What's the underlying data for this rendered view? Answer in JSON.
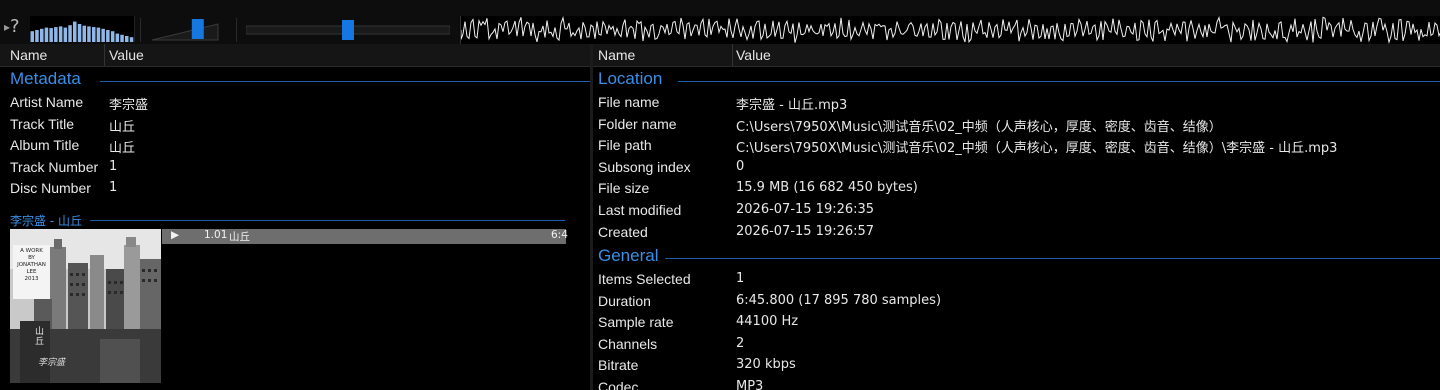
{
  "toolbar": {
    "help_label": "?",
    "icons": [
      "help-icon",
      "spectrum-visualizer",
      "volume-slider",
      "seek-slider",
      "waveform-seekbar"
    ],
    "spectrum_levels": [
      0.45,
      0.5,
      0.55,
      0.6,
      0.58,
      0.62,
      0.65,
      0.6,
      0.7,
      0.85,
      0.75,
      0.68,
      0.65,
      0.62,
      0.6,
      0.55,
      0.5,
      0.45,
      0.35,
      0.3,
      0.25,
      0.2
    ],
    "volume_level": 0.72,
    "seek_position": 0.5,
    "accent_color": "#1677e0"
  },
  "left": {
    "columns": {
      "name": "Name",
      "value": "Value"
    },
    "group": "Metadata",
    "rows": [
      {
        "key": "Artist Name",
        "value": "李宗盛"
      },
      {
        "key": "Track Title",
        "value": "山丘"
      },
      {
        "key": "Album Title",
        "value": "山丘"
      },
      {
        "key": "Track Number",
        "value": "1"
      },
      {
        "key": "Disc Number",
        "value": "1"
      }
    ],
    "album": {
      "header": "李宗盛 - 山丘",
      "cover_lines": [
        "A WORK",
        "BY",
        "JONATHAN",
        "LEE",
        "2013"
      ],
      "cover_vertical_text": "山丘",
      "cover_signature": "李宗盛",
      "playlist_row": {
        "number": "1.01",
        "title": "山丘",
        "duration": "6:4"
      }
    }
  },
  "right": {
    "columns": {
      "name": "Name",
      "value": "Value"
    },
    "location_group": "Location",
    "location_rows": [
      {
        "key": "File name",
        "value": "李宗盛 - 山丘.mp3"
      },
      {
        "key": "Folder name",
        "value": "C:\\Users\\7950X\\Music\\测试音乐\\02_中频（人声核心，厚度、密度、齿音、结像）"
      },
      {
        "key": "File path",
        "value": "C:\\Users\\7950X\\Music\\测试音乐\\02_中频（人声核心，厚度、密度、齿音、结像）\\李宗盛 - 山丘.mp3"
      },
      {
        "key": "Subsong index",
        "value": "0"
      },
      {
        "key": "File size",
        "value": "15.9 MB (16 682 450 bytes)"
      },
      {
        "key": "Last modified",
        "value": "2026-07-15 19:26:35"
      },
      {
        "key": "Created",
        "value": "2026-07-15 19:26:57"
      }
    ],
    "general_group": "General",
    "general_rows": [
      {
        "key": "Items Selected",
        "value": "1"
      },
      {
        "key": "Duration",
        "value": "6:45.800 (17 895 780 samples)"
      },
      {
        "key": "Sample rate",
        "value": "44100 Hz"
      },
      {
        "key": "Channels",
        "value": "2"
      },
      {
        "key": "Bitrate",
        "value": "320 kbps"
      },
      {
        "key": "Codec",
        "value": "MP3"
      }
    ]
  }
}
